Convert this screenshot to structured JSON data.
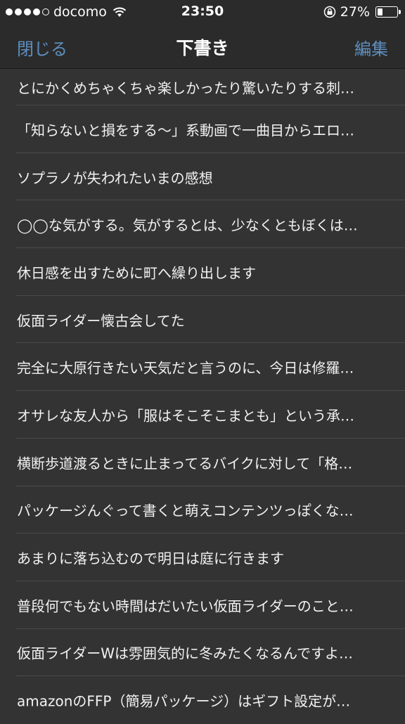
{
  "status_bar": {
    "carrier": "docomo",
    "time": "23:50",
    "battery_percent": "27%",
    "battery_level": 0.27
  },
  "nav": {
    "left_label": "閉じる",
    "title": "下書き",
    "right_label": "編集"
  },
  "drafts": [
    "とにかくめちゃくちゃ楽しかったり驚いたりする刺…",
    "「知らないと損をする〜」系動画で一曲目からエロ…",
    "ソプラノが失われたいまの感想",
    "◯◯な気がする。気がするとは、少なくともぼくは…",
    "休日感を出すために町へ繰り出します",
    "仮面ライダー懐古会してた",
    "完全に大原行きたい天気だと言うのに、今日は修羅…",
    "オサレな友人から「服はそこそこまとも」という承…",
    "横断歩道渡るときに止まってるバイクに対して「格…",
    "パッケージんぐって書くと萌えコンテンツっぽくな…",
    "あまりに落ち込むので明日は庭に行きます",
    "普段何でもない時間はだいたい仮面ライダーのこと…",
    "仮面ライダーWは雰囲気的に冬みたくなるんですよ…",
    "amazonのFFP（簡易パッケージ）はギフト設定が…"
  ]
}
